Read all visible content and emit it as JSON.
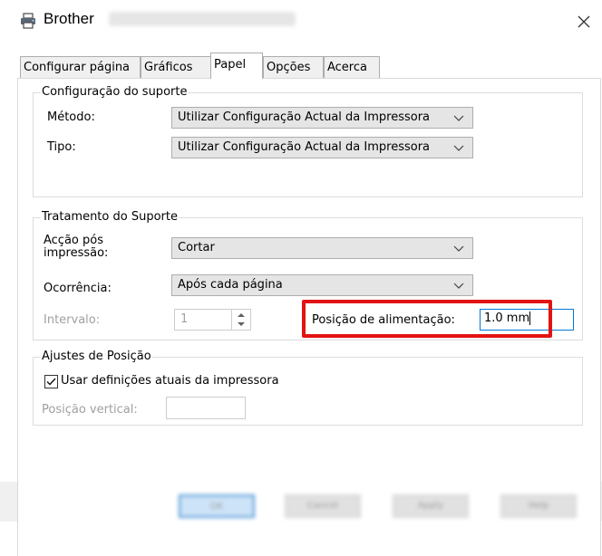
{
  "window": {
    "app_title": "Brother",
    "title_icon": "printer-icon",
    "close_icon": "close-icon"
  },
  "tabs": [
    {
      "label": "Configurar página"
    },
    {
      "label": "Gráficos"
    },
    {
      "label": "Papel",
      "active": true
    },
    {
      "label": "Opções"
    },
    {
      "label": "Acerca"
    }
  ],
  "media_settings": {
    "legend": "Configuração do suporte",
    "method_label": "Método:",
    "method_value": "Utilizar Configuração Actual da Impressora",
    "type_label": "Tipo:",
    "type_value": "Utilizar Configuração Actual da Impressora"
  },
  "media_handling": {
    "legend": "Tratamento do Suporte",
    "after_print_label_1": "Acção pós",
    "after_print_label_2": "impressão:",
    "after_print_value": "Cortar",
    "occurrence_label": "Ocorrência:",
    "occurrence_value": "Após cada página",
    "interval_label": "Intervalo:",
    "interval_value": "1",
    "feed_position_label": "Posição de alimentação:",
    "feed_position_value": "1.0 mm"
  },
  "position_adjust": {
    "legend": "Ajustes de Posição",
    "use_current_label": "Usar definições atuais da impressora",
    "use_current_checked": true,
    "vertical_label": "Posição vertical:",
    "vertical_value": ""
  },
  "buttons": {
    "ok": "OK",
    "cancel": "Cancel",
    "apply": "Apply",
    "help": "Help"
  },
  "colors": {
    "highlight": "#e21313",
    "focus_border": "#0078d7",
    "combo_bg": "#e5e5e5"
  }
}
